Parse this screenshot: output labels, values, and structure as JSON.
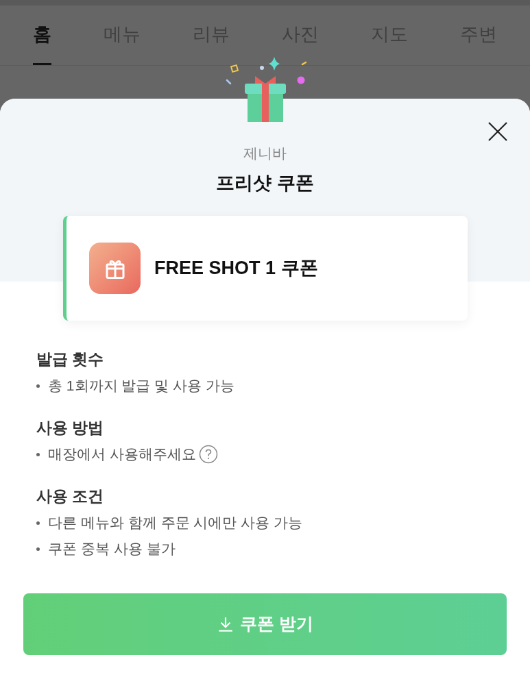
{
  "tabs": [
    {
      "label": "홈",
      "selected": true
    },
    {
      "label": "메뉴",
      "selected": false
    },
    {
      "label": "리뷰",
      "selected": false
    },
    {
      "label": "사진",
      "selected": false
    },
    {
      "label": "지도",
      "selected": false
    },
    {
      "label": "주변",
      "selected": false
    }
  ],
  "sheet": {
    "store_name": "제니바",
    "title": "프리샷 쿠폰",
    "coupon": {
      "name": "FREE SHOT 1 쿠폰"
    },
    "sections": [
      {
        "heading": "발급 횟수",
        "items": [
          {
            "text": "총 1회까지 발급 및 사용 가능",
            "help": false
          }
        ]
      },
      {
        "heading": "사용 방법",
        "items": [
          {
            "text": "매장에서 사용해주세요",
            "help": true
          }
        ]
      },
      {
        "heading": "사용 조건",
        "items": [
          {
            "text": "다른 메뉴와 함께 주문 시에만 사용 가능",
            "help": false
          },
          {
            "text": "쿠폰 중복 사용 불가",
            "help": false
          }
        ]
      }
    ],
    "button": "쿠폰 받기"
  }
}
